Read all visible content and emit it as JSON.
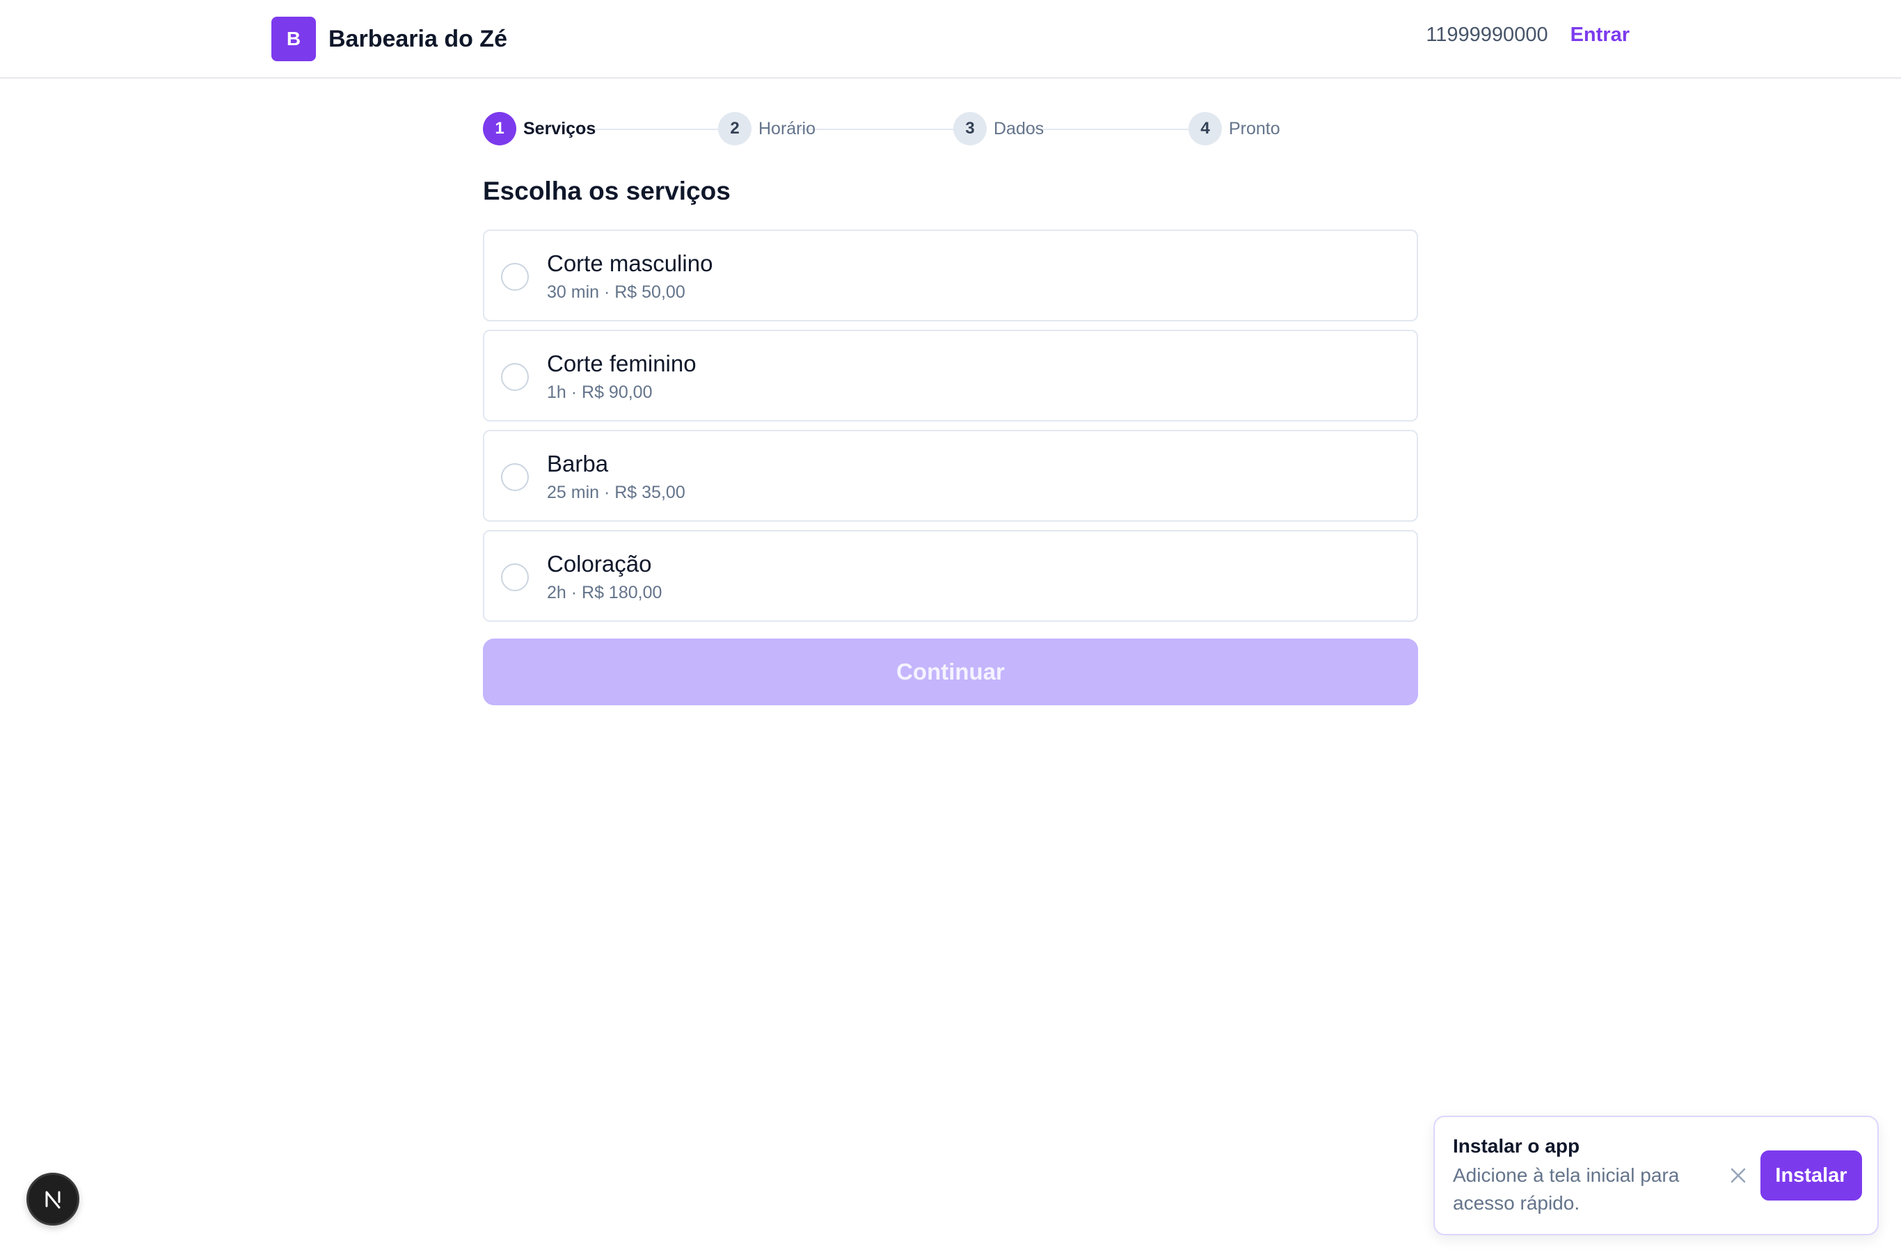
{
  "header": {
    "brand_initial": "B",
    "brand_name": "Barbearia do Zé",
    "phone": "11999990000",
    "login_label": "Entrar"
  },
  "stepper": {
    "steps": [
      {
        "number": "1",
        "label": "Serviços",
        "state": "active"
      },
      {
        "number": "2",
        "label": "Horário",
        "state": "inactive"
      },
      {
        "number": "3",
        "label": "Dados",
        "state": "inactive"
      },
      {
        "number": "4",
        "label": "Pronto",
        "state": "inactive"
      }
    ]
  },
  "section": {
    "title": "Escolha os serviços"
  },
  "services": [
    {
      "name": "Corte masculino",
      "meta": "30 min · R$ 50,00",
      "selected": false
    },
    {
      "name": "Corte feminino",
      "meta": "1h · R$ 90,00",
      "selected": false
    },
    {
      "name": "Barba",
      "meta": "25 min · R$ 35,00",
      "selected": false
    },
    {
      "name": "Coloração",
      "meta": "2h · R$ 180,00",
      "selected": false
    }
  ],
  "actions": {
    "continue_label": "Continuar",
    "continue_disabled": true
  },
  "install_toast": {
    "title": "Instalar o app",
    "body": "Adicione à tela inicial para acesso rápido.",
    "install_label": "Instalar",
    "close_icon": "close-icon"
  },
  "dev_badge": {
    "letter": "N"
  },
  "colors": {
    "accent": "#7c3aed",
    "accent_disabled": "#c4b5fd",
    "border": "#e2e8f0",
    "muted_text": "#64748b"
  }
}
